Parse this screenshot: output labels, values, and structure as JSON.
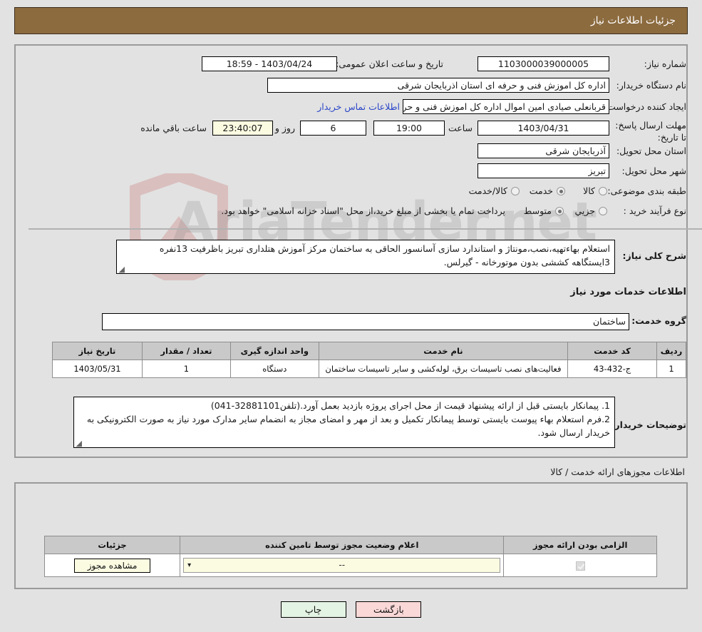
{
  "header": {
    "title": "جزئیات اطلاعات نیاز",
    "bg_color": "#8C6B3F"
  },
  "watermark": {
    "text": "AriaTender.net"
  },
  "need_info": {
    "need_number_label": "شماره نیاز:",
    "need_number_value": "1103000039000005",
    "announce_datetime_label": "تاریخ و ساعت اعلان عمومی:",
    "announce_datetime_value": "1403/04/24 - 18:59",
    "buyer_org_label": "نام دستگاه خریدار:",
    "buyer_org_value": "اداره کل اموزش فنی و حرفه ای استان اذربایجان شرقی",
    "requester_label": "ایجاد کننده درخواست:",
    "requester_value": "قربانعلی صیادی امین اموال اداره کل اموزش فنی و حرفه ای استان اذربایجان شر",
    "contact_link": "اطلاعات تماس خریدار",
    "deadline_label": "مهلت ارسال پاسخ: تا تاریخ:",
    "deadline_date": "1403/04/31",
    "hour_label": "ساعت",
    "deadline_time": "19:00",
    "days_value": "6",
    "days_suffix": "روز و",
    "countdown_value": "23:40:07",
    "remaining_label": "ساعت باقي مانده",
    "province_label": "استان محل تحویل:",
    "province_value": "آذربایجان شرقی",
    "city_label": "شهر محل تحویل:",
    "city_value": "تبریز",
    "category_label": "طبقه بندی موضوعی:",
    "category_options": [
      {
        "label": "کالا",
        "selected": false
      },
      {
        "label": "خدمت",
        "selected": true
      },
      {
        "label": "کالا/خدمت",
        "selected": false
      }
    ],
    "process_label": "نوع فرآیند خرید :",
    "process_options": [
      {
        "label": "جزیي",
        "selected": false
      },
      {
        "label": "متوسط",
        "selected": true
      }
    ],
    "payment_note": "پرداخت تمام یا بخشی از مبلغ خرید،از محل \"اسناد خزانه اسلامی\" خواهد بود."
  },
  "description": {
    "label": "شرح کلی نیاز:",
    "text": "استعلام بهاءتهیه،نصب،مونتاژ و استاندارد سازی آسانسور الحاقی به ساختمان مرکز آموزش هتلداری تبریز باظرفیت 13نفره 3ایستگاهه کششی بدون موتورخانه - گیرلس."
  },
  "services_section": {
    "title": "اطلاعات خدمات مورد نیاز",
    "group_label": "گروه خدمت:",
    "group_value": "ساختمان",
    "columns": [
      "ردیف",
      "کد خدمت",
      "نام خدمت",
      "واحد اندازه گیری",
      "تعداد / مقدار",
      "تاریخ نیاز"
    ],
    "rows": [
      {
        "row_no": "1",
        "code": "ج-432-43",
        "name": "فعالیت‌های نصب تاسیسات برق، لوله‌کشی و سایر تاسیسات ساختمان",
        "unit": "دستگاه",
        "qty": "1",
        "need_date": "1403/05/31"
      }
    ]
  },
  "buyer_notes": {
    "label": "توضیحات خریدار:",
    "lines": [
      "1. پیمانکار بایستی قبل از ارائه پیشنهاد قیمت از محل اجرای پروژه بازدید بعمل آورد.(تلفن32881101-041)",
      "2.فرم استعلام بهاء پیوست بایستی توسط پیمانکار تکمیل و بعد از مهر و امضای مجاز به انضمام سایر مدارک مورد نیاز به صورت الکترونیکی به خریدار ارسال شود."
    ]
  },
  "permits_section": {
    "title": "اطلاعات مجوزهای ارائه خدمت / کالا",
    "columns": [
      "الزامی بودن ارائه مجوز",
      "اعلام وضعیت مجوز توسط تامین کننده",
      "جزئیات"
    ],
    "rows": [
      {
        "required_checked": true,
        "status_value": "--",
        "details_button": "مشاهده مجوز"
      }
    ]
  },
  "footer": {
    "print_button": "چاپ",
    "back_button": "بازگشت"
  }
}
